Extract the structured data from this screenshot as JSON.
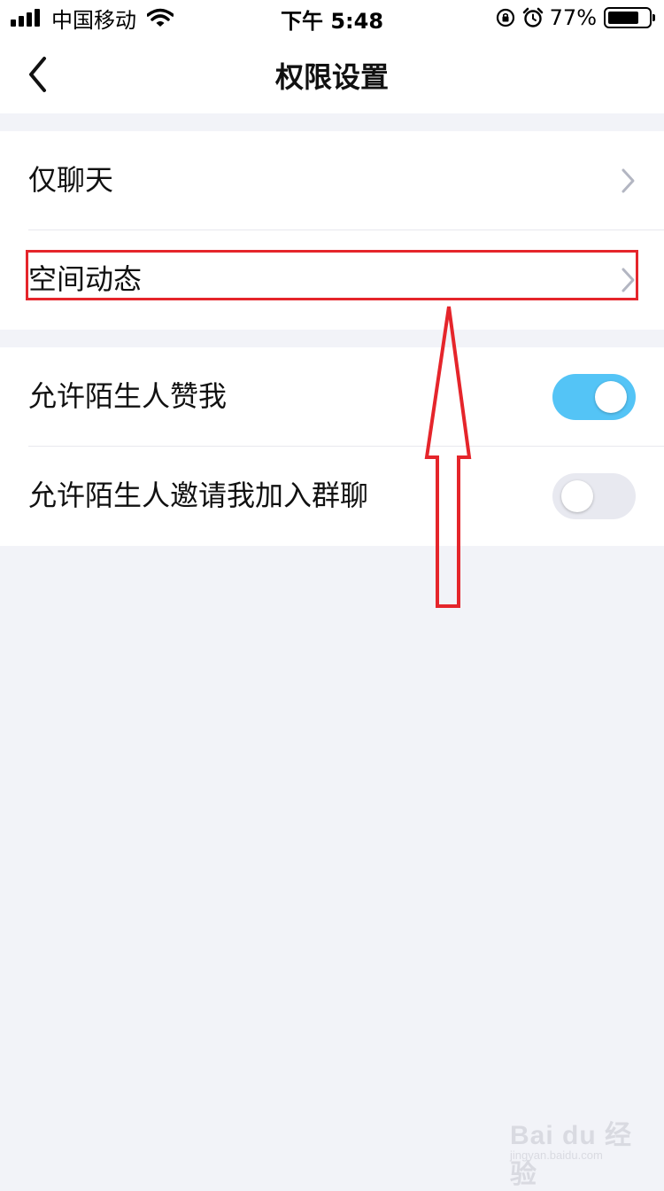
{
  "status_bar": {
    "carrier": "中国移动",
    "time": "下午 5:48",
    "battery_percent": "77%",
    "battery_level": 0.77,
    "icons": [
      "signal-icon",
      "wifi-icon",
      "orientation-lock-icon",
      "alarm-icon",
      "battery-icon"
    ]
  },
  "nav": {
    "title": "权限设置",
    "back_icon": "chevron-left-icon"
  },
  "settings": {
    "group1": [
      {
        "label": "仅聊天"
      },
      {
        "label": "空间动态"
      }
    ],
    "group2": [
      {
        "label": "允许陌生人赞我",
        "enabled": true
      },
      {
        "label": "允许陌生人邀请我加入群聊",
        "enabled": false
      }
    ]
  },
  "colors": {
    "toggle_on": "#54c4f6",
    "toggle_off": "#e8e9f0",
    "annotation": "#e5252b",
    "page_background": "#f2f3f8"
  },
  "watermark": {
    "logo": "Bai du 经验",
    "url": "jingyan.baidu.com"
  }
}
